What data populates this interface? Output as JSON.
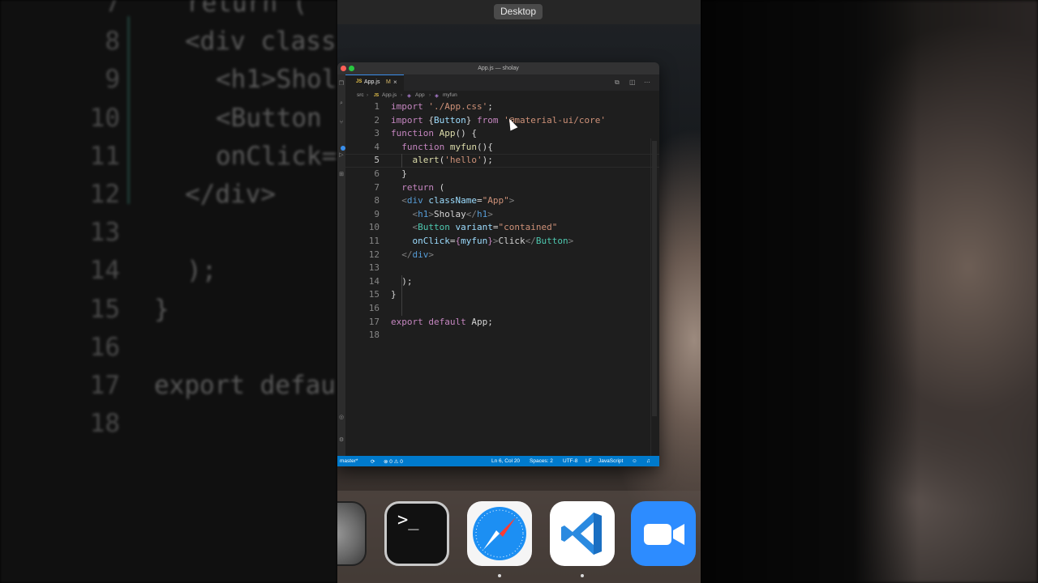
{
  "background_code": {
    "lines": [
      {
        "num": "7",
        "code": "return ("
      },
      {
        "num": "8",
        "code": "<div class"
      },
      {
        "num": "9",
        "code": "<h1>Shol"
      },
      {
        "num": "10",
        "code": "<Button "
      },
      {
        "num": "11",
        "code": "onClick="
      },
      {
        "num": "12",
        "code": "</div>"
      },
      {
        "num": "13",
        "code": ""
      },
      {
        "num": "14",
        "code": ");"
      },
      {
        "num": "15",
        "code": "}"
      },
      {
        "num": "16",
        "code": ""
      },
      {
        "num": "17",
        "code": "export defau"
      },
      {
        "num": "18",
        "code": ""
      }
    ]
  },
  "desktop_label": "Desktop",
  "window": {
    "title": "App.js — sholay",
    "tab": {
      "type": "JS",
      "name": "App.js",
      "modified": "M",
      "close": "×"
    },
    "breadcrumb": [
      "src",
      "App.js",
      "App",
      "myfun"
    ]
  },
  "editor": {
    "lines": [
      {
        "num": "1",
        "tokens": [
          [
            "kw",
            "import "
          ],
          [
            "str",
            "'./App.css'"
          ],
          [
            "pl",
            ";"
          ]
        ]
      },
      {
        "num": "2",
        "tokens": [
          [
            "kw",
            "import "
          ],
          [
            "pl",
            "{"
          ],
          [
            "var",
            "Button"
          ],
          [
            "pl",
            "} "
          ],
          [
            "kw",
            "from "
          ],
          [
            "str",
            "'@material-ui/core'"
          ]
        ]
      },
      {
        "num": "3",
        "tokens": [
          [
            "kw",
            "function "
          ],
          [
            "fn",
            "App"
          ],
          [
            "pl",
            "() {"
          ]
        ]
      },
      {
        "num": "4",
        "tokens": [
          [
            "pl",
            "  "
          ],
          [
            "kw",
            "function "
          ],
          [
            "fn",
            "myfun"
          ],
          [
            "pl",
            "(){"
          ]
        ]
      },
      {
        "num": "5",
        "tokens": [
          [
            "pl",
            "    "
          ],
          [
            "fn",
            "alert"
          ],
          [
            "pl",
            "("
          ],
          [
            "str",
            "'hello'"
          ],
          [
            "pl",
            ");"
          ]
        ]
      },
      {
        "num": "6",
        "tokens": [
          [
            "pl",
            "  }"
          ]
        ]
      },
      {
        "num": "7",
        "tokens": [
          [
            "pl",
            "  "
          ],
          [
            "kw",
            "return "
          ],
          [
            "pl",
            "("
          ]
        ]
      },
      {
        "num": "8",
        "tokens": [
          [
            "pl",
            "  "
          ],
          [
            "tagc",
            "<"
          ],
          [
            "tag",
            "div "
          ],
          [
            "attr",
            "className"
          ],
          [
            "pl",
            "="
          ],
          [
            "str",
            "\"App\""
          ],
          [
            "tagc",
            ">"
          ]
        ]
      },
      {
        "num": "9",
        "tokens": [
          [
            "pl",
            "    "
          ],
          [
            "tagc",
            "<"
          ],
          [
            "tag",
            "h1"
          ],
          [
            "tagc",
            ">"
          ],
          [
            "pl",
            "Sholay"
          ],
          [
            "tagc",
            "</"
          ],
          [
            "tag",
            "h1"
          ],
          [
            "tagc",
            ">"
          ]
        ]
      },
      {
        "num": "10",
        "tokens": [
          [
            "pl",
            "    "
          ],
          [
            "tagc",
            "<"
          ],
          [
            "comp",
            "Button "
          ],
          [
            "attr",
            "variant"
          ],
          [
            "pl",
            "="
          ],
          [
            "str",
            "\"contained\""
          ]
        ]
      },
      {
        "num": "11",
        "tokens": [
          [
            "pl",
            "    "
          ],
          [
            "attr",
            "onClick"
          ],
          [
            "pl",
            "="
          ],
          [
            "kw",
            "{"
          ],
          [
            "var",
            "myfun"
          ],
          [
            "kw",
            "}"
          ],
          [
            "tagc",
            ">"
          ],
          [
            "pl",
            "Click"
          ],
          [
            "tagc",
            "</"
          ],
          [
            "comp",
            "Button"
          ],
          [
            "tagc",
            ">"
          ]
        ]
      },
      {
        "num": "12",
        "tokens": [
          [
            "pl",
            "  "
          ],
          [
            "tagc",
            "</"
          ],
          [
            "tag",
            "div"
          ],
          [
            "tagc",
            ">"
          ]
        ]
      },
      {
        "num": "13",
        "tokens": []
      },
      {
        "num": "14",
        "tokens": [
          [
            "pl",
            "  );"
          ]
        ]
      },
      {
        "num": "15",
        "tokens": [
          [
            "pl",
            "}"
          ]
        ]
      },
      {
        "num": "16",
        "tokens": []
      },
      {
        "num": "17",
        "tokens": [
          [
            "kw",
            "export default "
          ],
          [
            "pl",
            "App;"
          ]
        ]
      },
      {
        "num": "18",
        "tokens": []
      }
    ],
    "active_line": "5"
  },
  "statusbar": {
    "branch": "master*",
    "sync": "⟳",
    "problems": "⊗ 0 ⚠ 0",
    "position": "Ln 6, Col 20",
    "spaces": "Spaces: 2",
    "encoding": "UTF-8",
    "eol": "LF",
    "language": "JavaScript"
  },
  "dock": {
    "apps": [
      "System Preferences",
      "Terminal",
      "Safari",
      "Visual Studio Code",
      "Zoom"
    ],
    "terminal_prompt": ">_"
  },
  "colors": {
    "statusbar": "#007acc",
    "editor_bg": "#1e1e1e",
    "keyword": "#c586c0",
    "string": "#ce9178",
    "function": "#dcdcaa"
  }
}
